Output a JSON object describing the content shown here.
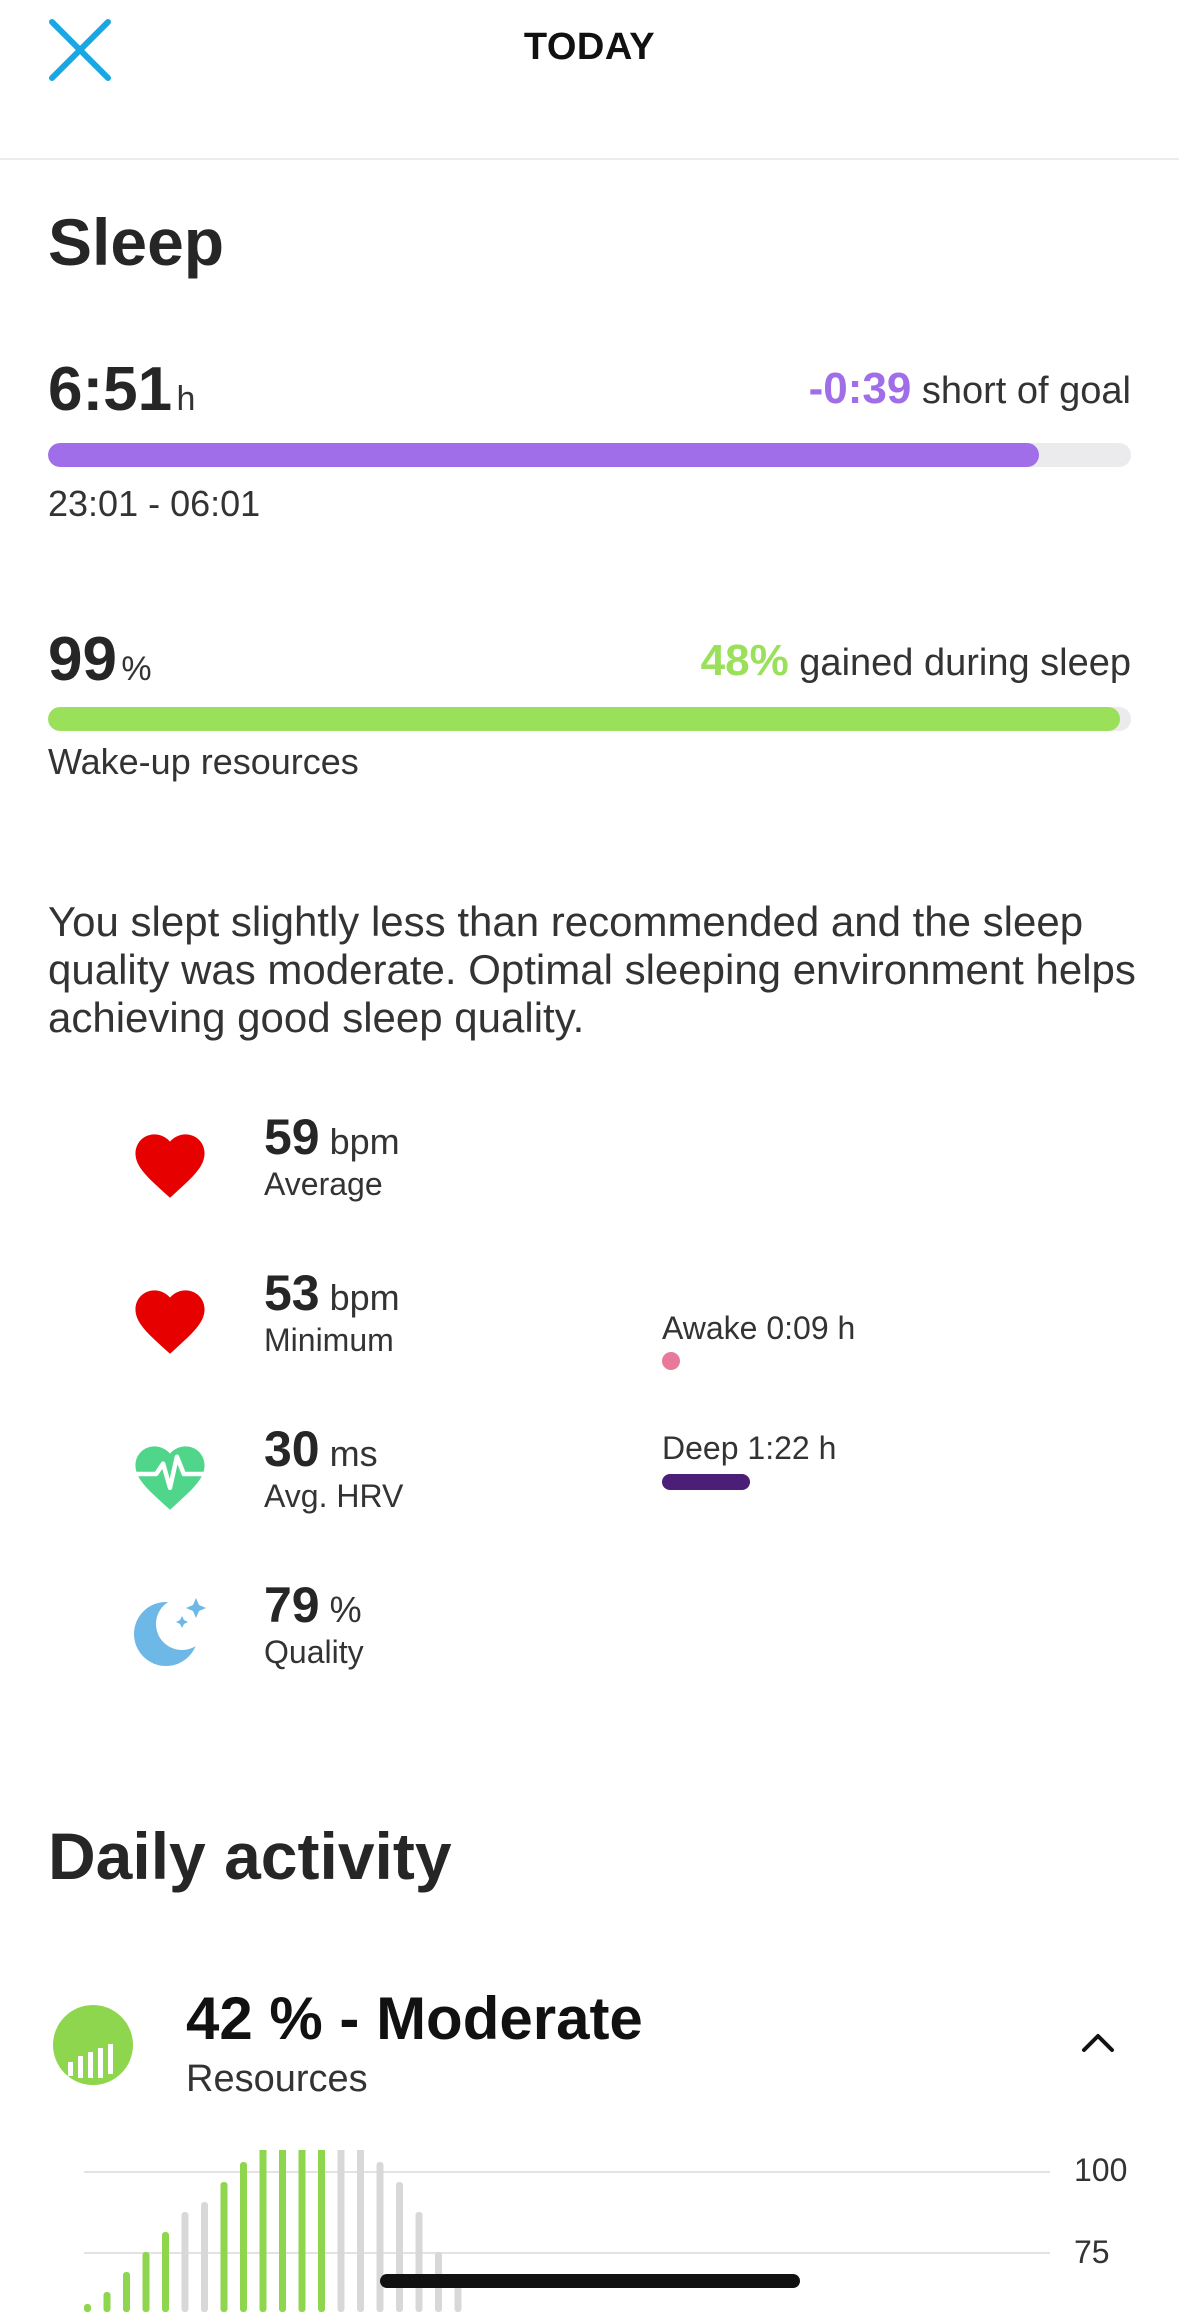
{
  "header": {
    "title": "TODAY",
    "close_icon": "close-icon"
  },
  "sleep": {
    "title": "Sleep",
    "duration": {
      "value": "6:51",
      "unit": "h",
      "diff": "-0:39",
      "diff_text": "short of goal",
      "range": "23:01 - 06:01",
      "progress": 0.915,
      "color": "#a06ee8"
    },
    "resources": {
      "value": "99",
      "unit": "%",
      "gain": "48%",
      "gain_text": "gained during sleep",
      "label": "Wake-up resources",
      "progress": 0.99,
      "color": "#9be05a"
    },
    "summary": "You slept slightly less than recommended and the sleep quality was moderate. Optimal sleeping environment helps achieving good sleep quality.",
    "metrics": [
      {
        "icon": "heart-icon",
        "value": "59",
        "unit": "bpm",
        "label": "Average"
      },
      {
        "icon": "heart-icon",
        "value": "53",
        "unit": "bpm",
        "label": "Minimum"
      },
      {
        "icon": "hrv-heart-icon",
        "value": "30",
        "unit": "ms",
        "label": "Avg. HRV"
      },
      {
        "icon": "moon-icon",
        "value": "79",
        "unit": "%",
        "label": "Quality"
      }
    ],
    "stages": [
      {
        "label": "Awake 0:09 h",
        "color": "#e8799a"
      },
      {
        "label": "Deep 1:22 h",
        "color": "#4b1f77"
      }
    ]
  },
  "activity": {
    "title": "Daily activity",
    "resources_value": "42 % - Moderate",
    "resources_label": "Resources",
    "icon": "resources-icon",
    "chevron_icon": "chevron-up-icon",
    "chart": {
      "y_ticks": [
        "100",
        "75"
      ]
    }
  }
}
